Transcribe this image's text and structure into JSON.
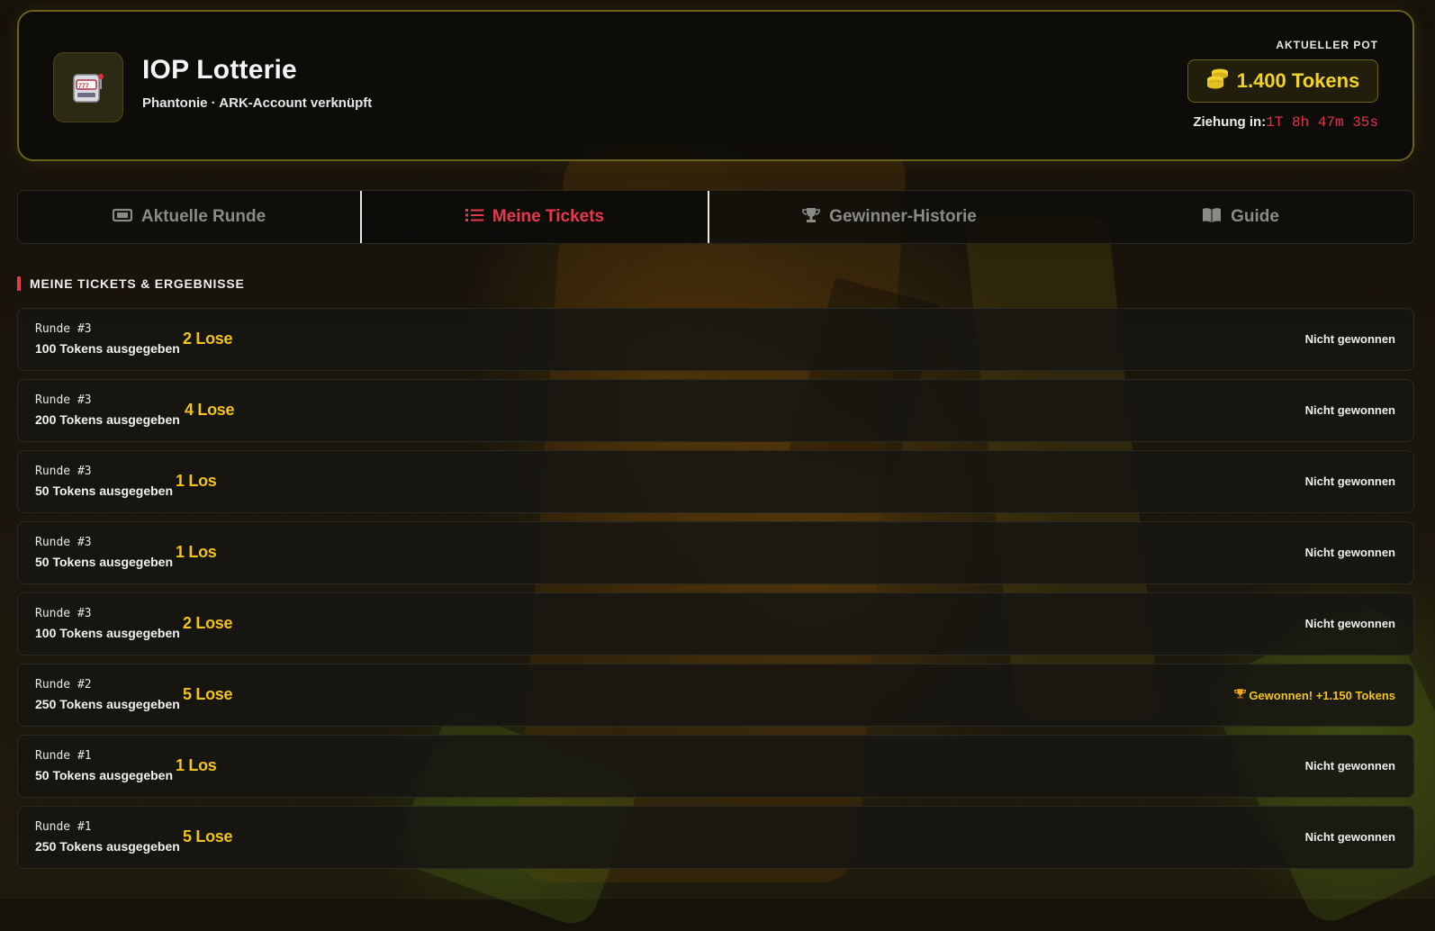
{
  "header": {
    "title": "IOP Lotterie",
    "subtitle": "Phantonie · ARK-Account verknüpft",
    "logo_icon": "slot-machine-icon",
    "pot_label": "AKTUELLER POT",
    "pot_value": "1.400 Tokens",
    "pot_icon": "coins-icon",
    "draw_label": "Ziehung in:",
    "draw_countdown": "1T 8h 47m 35s"
  },
  "tabs": [
    {
      "label": "Aktuelle Runde",
      "icon": "ticket-icon",
      "active": false
    },
    {
      "label": "Meine Tickets",
      "icon": "list-icon",
      "active": true
    },
    {
      "label": "Gewinner-Historie",
      "icon": "trophy-icon",
      "active": false
    },
    {
      "label": "Guide",
      "icon": "book-icon",
      "active": false
    }
  ],
  "section": {
    "title": "MEINE TICKETS & ERGEBNISSE"
  },
  "tickets": [
    {
      "round": "Runde  #3",
      "spent": "100 Tokens ausgegeben",
      "lose": "2 Lose",
      "result": "Nicht gewonnen",
      "won": false
    },
    {
      "round": "Runde  #3",
      "spent": "200 Tokens ausgegeben",
      "lose": "4 Lose",
      "result": "Nicht gewonnen",
      "won": false
    },
    {
      "round": "Runde  #3",
      "spent": "50 Tokens ausgegeben",
      "lose": "1 Los",
      "result": "Nicht gewonnen",
      "won": false
    },
    {
      "round": "Runde  #3",
      "spent": "50 Tokens ausgegeben",
      "lose": "1 Los",
      "result": "Nicht gewonnen",
      "won": false
    },
    {
      "round": "Runde  #3",
      "spent": "100 Tokens ausgegeben",
      "lose": "2 Lose",
      "result": "Nicht gewonnen",
      "won": false
    },
    {
      "round": "Runde  #2",
      "spent": "250 Tokens ausgegeben",
      "lose": "5 Lose",
      "result": "Gewonnen! +1.150 Tokens",
      "won": true
    },
    {
      "round": "Runde  #1",
      "spent": "50 Tokens ausgegeben",
      "lose": "1 Los",
      "result": "Nicht gewonnen",
      "won": false
    },
    {
      "round": "Runde  #1",
      "spent": "250 Tokens ausgegeben",
      "lose": "5 Lose",
      "result": "Nicht gewonnen",
      "won": false
    }
  ],
  "colors": {
    "accent_red": "#e8384e",
    "gold": "#f2c41a",
    "border_gold": "#6b6219"
  }
}
